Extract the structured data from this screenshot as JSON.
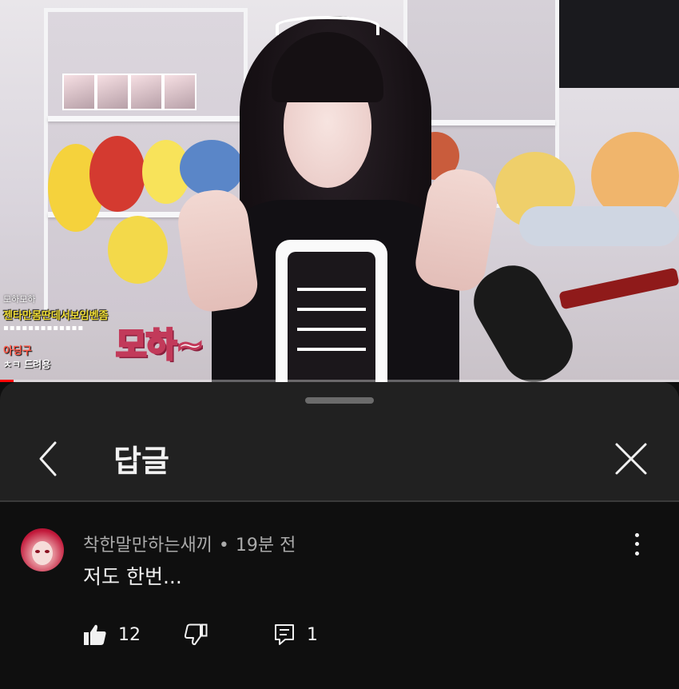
{
  "video": {
    "overlay": {
      "small_caption": "모하모하",
      "yellow_caption": "젠타만몸딴데서보임벤좀",
      "chips": "▪▪▪▪▪▪▪▪▪▪▪▪▪",
      "red_caption": "아딩구",
      "white_caption": "ㅊㅋ 드려용",
      "big_caption": "모하~"
    },
    "progress_fraction": 0.02
  },
  "sheet": {
    "back_icon": "chevron-left-icon",
    "title": "답글",
    "close_icon": "close-icon"
  },
  "comment": {
    "author": "착한말만하는새끼",
    "separator": "•",
    "time": "19분 전",
    "text": "저도 한번...",
    "likes": "12",
    "replies": "1",
    "like_icon": "thumbs-up-icon",
    "dislike_icon": "thumbs-down-icon",
    "reply_icon": "reply-icon",
    "menu_icon": "more-vert-icon"
  },
  "colors": {
    "sheet_bg": "#212121",
    "comment_bg": "#0f0f0f",
    "primary_text": "#f1f1f1",
    "secondary_text": "#aaaaaa",
    "progress": "#ff0000"
  }
}
